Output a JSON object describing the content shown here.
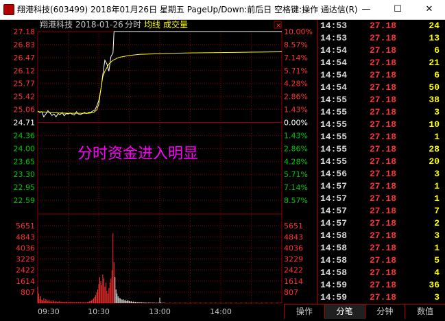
{
  "window": {
    "title": "翔港科技(603499) 2018年01月26日 星期五 PageUp/Down:前后日 空格键:操作 通达信(R)",
    "minimize_glyph": "—",
    "maximize_glyph": "☐",
    "close_glyph": "✕"
  },
  "chart_header": {
    "stock_name": "翔港科技",
    "date": "2018-01-26",
    "chart_type": "分时",
    "avg_line_label": "均线",
    "volume_label": "成交量",
    "close_box": "×"
  },
  "annotation": "分时资金进入明显",
  "colors": {
    "up": "#ff3232",
    "down": "#00c800",
    "flat": "#ffffff",
    "price_line": "#ffffff",
    "avg_line": "#ffff00",
    "grid": "#8b0000",
    "annotation": "#ff00ff",
    "volume_bars": "#ff3232"
  },
  "chart_data": [
    {
      "type": "line",
      "title": "",
      "series": [
        {
          "name": "",
          "points": [
            [
              0,
              25.02
            ],
            [
              2,
              24.98
            ],
            [
              4,
              25.0
            ],
            [
              6,
              24.86
            ],
            [
              8,
              24.94
            ],
            [
              10,
              25.03
            ],
            [
              12,
              24.97
            ],
            [
              14,
              24.9
            ],
            [
              16,
              24.94
            ],
            [
              18,
              24.86
            ],
            [
              20,
              24.95
            ],
            [
              22,
              24.92
            ],
            [
              24,
              24.98
            ],
            [
              26,
              24.89
            ],
            [
              28,
              24.95
            ],
            [
              30,
              24.94
            ],
            [
              32,
              24.97
            ],
            [
              34,
              24.93
            ],
            [
              36,
              24.91
            ],
            [
              38,
              25.0
            ],
            [
              40,
              24.94
            ],
            [
              42,
              24.92
            ],
            [
              44,
              24.95
            ],
            [
              46,
              24.98
            ],
            [
              48,
              24.95
            ],
            [
              50,
              24.98
            ],
            [
              52,
              24.98
            ],
            [
              54,
              25.02
            ],
            [
              56,
              25.04
            ],
            [
              58,
              25.15
            ],
            [
              60,
              25.3
            ],
            [
              62,
              25.6
            ],
            [
              64,
              26.0
            ],
            [
              66,
              26.4
            ],
            [
              68,
              26.3
            ],
            [
              70,
              26.1
            ],
            [
              72,
              26.5
            ],
            [
              74,
              26.6
            ],
            [
              75,
              27.18
            ],
            [
              80,
              27.18
            ],
            [
              100,
              27.18
            ],
            [
              150,
              27.18
            ],
            [
              200,
              27.18
            ],
            [
              240,
              27.18
            ]
          ]
        },
        {
          "name": "均线",
          "points": [
            [
              0,
              25.0
            ],
            [
              10,
              24.99
            ],
            [
              20,
              24.97
            ],
            [
              30,
              24.96
            ],
            [
              40,
              24.96
            ],
            [
              50,
              24.96
            ],
            [
              55,
              24.98
            ],
            [
              58,
              25.05
            ],
            [
              60,
              25.2
            ],
            [
              62,
              25.6
            ],
            [
              64,
              25.95
            ],
            [
              66,
              26.1
            ],
            [
              68,
              26.2
            ],
            [
              70,
              26.3
            ],
            [
              72,
              26.35
            ],
            [
              74,
              26.4
            ],
            [
              80,
              26.48
            ],
            [
              90,
              26.53
            ],
            [
              100,
              26.56
            ],
            [
              120,
              26.58
            ],
            [
              150,
              26.6
            ],
            [
              180,
              26.61
            ],
            [
              210,
              26.62
            ],
            [
              240,
              26.63
            ]
          ]
        }
      ],
      "x_ticks": [
        "09:30",
        "10:30",
        "13:00",
        "14:00"
      ],
      "y_ticks_left": [
        "27.18",
        "26.83",
        "26.47",
        "26.12",
        "25.77",
        "25.42",
        "25.06",
        "24.71",
        "24.36",
        "24.00",
        "23.65",
        "23.30",
        "22.95",
        "22.59"
      ],
      "y_ticks_right": [
        "10.00%",
        "8.57%",
        "7.14%",
        "5.71%",
        "4.28%",
        "2.86%",
        "1.43%",
        "0.00%",
        "1.43%",
        "2.86%",
        "4.28%",
        "5.71%",
        "7.14%",
        "8.57%"
      ],
      "prev_close": 24.71,
      "ylim": [
        22.24,
        27.18
      ],
      "xlim": [
        0,
        240
      ]
    },
    {
      "type": "bar",
      "title": "",
      "y_ticks_left": [
        "5651",
        "4843",
        "4036",
        "3229",
        "2422",
        "1614",
        "807"
      ],
      "y_ticks_right": [
        "5651",
        "4843",
        "4036",
        "3229",
        "2422",
        "1614",
        "807"
      ],
      "ylim": [
        0,
        6458
      ],
      "xlim": [
        0,
        240
      ],
      "bars": [
        [
          0,
          1200
        ],
        [
          1,
          700
        ],
        [
          2,
          300
        ],
        [
          3,
          500
        ],
        [
          4,
          250
        ],
        [
          5,
          200
        ],
        [
          6,
          350
        ],
        [
          7,
          150
        ],
        [
          8,
          300
        ],
        [
          9,
          200
        ],
        [
          10,
          150
        ],
        [
          11,
          250
        ],
        [
          12,
          120
        ],
        [
          13,
          180
        ],
        [
          14,
          100
        ],
        [
          15,
          220
        ],
        [
          16,
          130
        ],
        [
          17,
          90
        ],
        [
          18,
          160
        ],
        [
          19,
          110
        ],
        [
          20,
          100
        ],
        [
          21,
          140
        ],
        [
          22,
          90
        ],
        [
          23,
          120
        ],
        [
          24,
          80
        ],
        [
          25,
          100
        ],
        [
          26,
          70
        ],
        [
          27,
          90
        ],
        [
          28,
          110
        ],
        [
          29,
          80
        ],
        [
          30,
          60
        ],
        [
          31,
          100
        ],
        [
          32,
          70
        ],
        [
          33,
          90
        ],
        [
          34,
          60
        ],
        [
          35,
          80
        ],
        [
          36,
          70
        ],
        [
          37,
          60
        ],
        [
          38,
          80
        ],
        [
          39,
          50
        ],
        [
          40,
          70
        ],
        [
          41,
          60
        ],
        [
          42,
          80
        ],
        [
          43,
          50
        ],
        [
          44,
          60
        ],
        [
          45,
          80
        ],
        [
          46,
          50
        ],
        [
          47,
          70
        ],
        [
          48,
          60
        ],
        [
          49,
          90
        ],
        [
          50,
          100
        ],
        [
          51,
          140
        ],
        [
          52,
          160
        ],
        [
          53,
          220
        ],
        [
          54,
          260
        ],
        [
          55,
          350
        ],
        [
          56,
          450
        ],
        [
          57,
          600
        ],
        [
          58,
          800
        ],
        [
          59,
          1000
        ],
        [
          60,
          1400
        ],
        [
          61,
          1900
        ],
        [
          62,
          1600
        ],
        [
          63,
          1300
        ],
        [
          64,
          2100
        ],
        [
          65,
          1800
        ],
        [
          66,
          1200
        ],
        [
          67,
          1500
        ],
        [
          68,
          900
        ],
        [
          69,
          700
        ],
        [
          70,
          1100
        ],
        [
          71,
          1500
        ],
        [
          72,
          1800
        ],
        [
          73,
          2400
        ],
        [
          74,
          5100
        ],
        [
          75,
          3000
        ],
        [
          76,
          1900
        ],
        [
          77,
          1000
        ],
        [
          78,
          700
        ],
        [
          79,
          500
        ],
        [
          80,
          400
        ],
        [
          81,
          350
        ],
        [
          82,
          300
        ],
        [
          83,
          250
        ],
        [
          84,
          300
        ],
        [
          85,
          200
        ],
        [
          86,
          250
        ],
        [
          87,
          150
        ],
        [
          88,
          200
        ],
        [
          89,
          180
        ],
        [
          90,
          150
        ],
        [
          91,
          120
        ],
        [
          92,
          140
        ],
        [
          93,
          100
        ],
        [
          94,
          120
        ],
        [
          95,
          90
        ],
        [
          96,
          100
        ],
        [
          97,
          80
        ],
        [
          98,
          70
        ],
        [
          99,
          90
        ],
        [
          100,
          60
        ],
        [
          101,
          70
        ],
        [
          102,
          80
        ],
        [
          103,
          50
        ],
        [
          104,
          60
        ],
        [
          105,
          40
        ],
        [
          106,
          50
        ],
        [
          107,
          40
        ],
        [
          108,
          30
        ],
        [
          109,
          50
        ],
        [
          110,
          40
        ],
        [
          111,
          30
        ],
        [
          112,
          40
        ],
        [
          113,
          30
        ],
        [
          114,
          40
        ],
        [
          115,
          30
        ],
        [
          116,
          20
        ],
        [
          117,
          30
        ],
        [
          118,
          20
        ],
        [
          119,
          30
        ],
        [
          120,
          400
        ],
        [
          121,
          60
        ],
        [
          122,
          30
        ],
        [
          123,
          20
        ],
        [
          124,
          30
        ],
        [
          125,
          20
        ],
        [
          130,
          20
        ],
        [
          135,
          20
        ],
        [
          140,
          20
        ],
        [
          145,
          20
        ],
        [
          150,
          20
        ],
        [
          155,
          20
        ],
        [
          160,
          20
        ],
        [
          165,
          20
        ],
        [
          170,
          20
        ],
        [
          175,
          20
        ],
        [
          180,
          20
        ],
        [
          185,
          20
        ],
        [
          190,
          20
        ],
        [
          195,
          20
        ],
        [
          200,
          20
        ],
        [
          205,
          20
        ],
        [
          210,
          20
        ],
        [
          215,
          20
        ],
        [
          220,
          20
        ],
        [
          225,
          20
        ],
        [
          230,
          20
        ],
        [
          235,
          20
        ],
        [
          239,
          20
        ]
      ]
    }
  ],
  "ticks": [
    {
      "time": "14:53",
      "price": "27.18",
      "volume": "24"
    },
    {
      "time": "14:53",
      "price": "27.18",
      "volume": "13"
    },
    {
      "time": "14:54",
      "price": "27.18",
      "volume": "6"
    },
    {
      "time": "14:54",
      "price": "27.18",
      "volume": "21"
    },
    {
      "time": "14:54",
      "price": "27.18",
      "volume": "6"
    },
    {
      "time": "14:54",
      "price": "27.18",
      "volume": "50"
    },
    {
      "time": "14:55",
      "price": "27.18",
      "volume": "38"
    },
    {
      "time": "14:55",
      "price": "27.18",
      "volume": "3"
    },
    {
      "time": "14:55",
      "price": "27.18",
      "volume": "10"
    },
    {
      "time": "14:55",
      "price": "27.18",
      "volume": "1"
    },
    {
      "time": "14:55",
      "price": "27.18",
      "volume": "28"
    },
    {
      "time": "14:55",
      "price": "27.18",
      "volume": "20"
    },
    {
      "time": "14:56",
      "price": "27.18",
      "volume": "3"
    },
    {
      "time": "14:57",
      "price": "27.18",
      "volume": "1"
    },
    {
      "time": "14:57",
      "price": "27.18",
      "volume": "1"
    },
    {
      "time": "14:57",
      "price": "27.18",
      "volume": "7"
    },
    {
      "time": "14:57",
      "price": "27.18",
      "volume": "2"
    },
    {
      "time": "14:58",
      "price": "27.18",
      "volume": "3"
    },
    {
      "time": "14:58",
      "price": "27.18",
      "volume": "1"
    },
    {
      "time": "14:58",
      "price": "27.18",
      "volume": "5"
    },
    {
      "time": "14:58",
      "price": "27.18",
      "volume": "4"
    },
    {
      "time": "14:59",
      "price": "27.18",
      "volume": "36"
    },
    {
      "time": "14:59",
      "price": "27.18",
      "volume": "3"
    }
  ],
  "bottom_tabs": [
    {
      "label": "操作",
      "active": false
    },
    {
      "label": "分笔",
      "active": true
    },
    {
      "label": "分钟",
      "active": false
    },
    {
      "label": "数值",
      "active": false
    }
  ]
}
